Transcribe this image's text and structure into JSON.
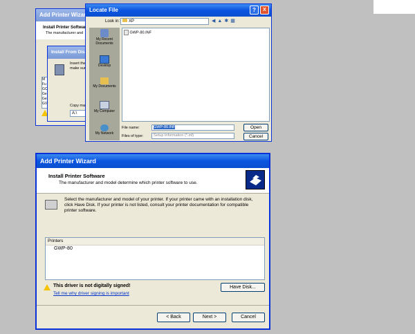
{
  "bg_wizard": {
    "title": "Add Printer Wizard",
    "heading": "Install Printer Software",
    "sub": "The manufacturer and",
    "list_items": [
      "M",
      "Fu",
      "GC",
      "Ge",
      "Ge",
      "GV"
    ]
  },
  "install_disk": {
    "title": "Install From Disk",
    "line1": "Insert the",
    "line2": "make sure",
    "copy_label": "Copy man",
    "copy_value": "A:\\"
  },
  "locate": {
    "title": "Locate File",
    "help_btn": "?",
    "close_btn": "X",
    "look_in_label": "Look in:",
    "look_in_value": "XP",
    "file_item": "GWP-80.INF",
    "places": [
      "My Recent Documents",
      "Desktop",
      "My Documents",
      "My Computer",
      "My Network"
    ],
    "file_name_label": "File name:",
    "file_name_value": "GWP-80.INF",
    "file_type_label": "Files of type:",
    "file_type_value": "Setup Information (*.inf)",
    "open_btn": "Open",
    "cancel_btn": "Cancel"
  },
  "wizard": {
    "title": "Add Printer Wizard",
    "heading": "Install Printer Software",
    "subheading": "The manufacturer and model determine which printer software to use.",
    "instructions": "Select the manufacturer and model of your printer. If your printer came with an installation disk, click Have Disk. If your printer is not listed, consult your printer documentation for compatible printer software.",
    "printers_header": "Printers",
    "printers": [
      "GWP-80"
    ],
    "warning": "This driver is not digitally signed!",
    "link": "Tell me why driver signing is important",
    "have_disk": "Have Disk...",
    "back": "< Back",
    "next": "Next >",
    "cancel": "Cancel"
  }
}
